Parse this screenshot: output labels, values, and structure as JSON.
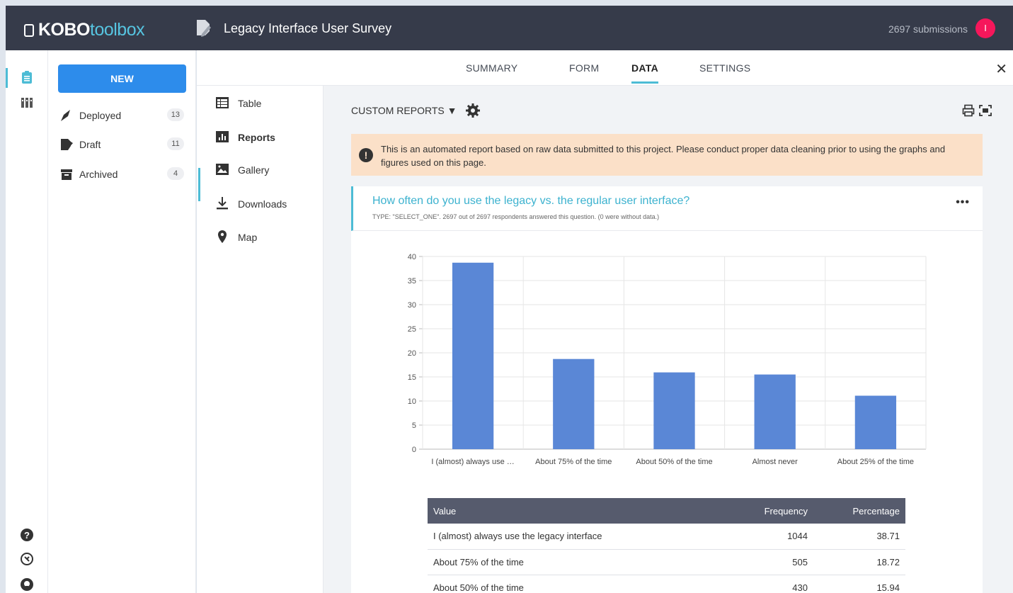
{
  "app": {
    "logo_bold": "KOBO",
    "logo_light": "toolbox",
    "project_title": "Legacy Interface User Survey",
    "submissions": "2697 submissions",
    "avatar_initial": "I",
    "accent_color": "#4dbcd5",
    "brand_blue": "#2d8ceb"
  },
  "rail": {
    "icons": [
      "clipboard-icon",
      "library-icon",
      "help-icon",
      "support-icon",
      "github-icon"
    ]
  },
  "sidebar": {
    "new_label": "NEW",
    "items": [
      {
        "label": "Deployed",
        "count": "13",
        "icon": "rocket-icon"
      },
      {
        "label": "Draft",
        "count": "11",
        "icon": "draft-icon"
      },
      {
        "label": "Archived",
        "count": "4",
        "icon": "archive-icon"
      }
    ]
  },
  "tabs": [
    {
      "label": "SUMMARY"
    },
    {
      "label": "FORM"
    },
    {
      "label": "DATA",
      "active": true
    },
    {
      "label": "SETTINGS"
    }
  ],
  "subnav": [
    {
      "label": "Table",
      "icon": "table-icon"
    },
    {
      "label": "Reports",
      "icon": "reports-icon",
      "active": true
    },
    {
      "label": "Gallery",
      "icon": "gallery-icon"
    },
    {
      "label": "Downloads",
      "icon": "download-icon"
    },
    {
      "label": "Map",
      "icon": "map-pin-icon"
    }
  ],
  "reports": {
    "custom_reports_label": "CUSTOM REPORTS ▼",
    "warning": "This is an automated report based on raw data submitted to this project. Please conduct proper data cleaning prior to using the graphs and figures used on this page.",
    "question": "How often do you use the legacy vs. the regular user interface?",
    "question_meta": "TYPE: \"SELECT_ONE\". 2697 out of 2697 respondents answered this question. (0 were without data.)",
    "more_label": "•••",
    "table": {
      "headers": [
        "Value",
        "Frequency",
        "Percentage"
      ],
      "rows": [
        [
          "I (almost) always use the legacy interface",
          "1044",
          "38.71"
        ],
        [
          "About 75% of the time",
          "505",
          "18.72"
        ],
        [
          "About 50% of the time",
          "430",
          "15.94"
        ]
      ]
    }
  },
  "chart_data": {
    "type": "bar",
    "categories": [
      "I (almost) always use …",
      "About 75% of the time",
      "About 50% of the time",
      "Almost never",
      "About 25% of the time"
    ],
    "values": [
      38.71,
      18.72,
      15.94,
      15.5,
      11.1
    ],
    "ylim": [
      0,
      40
    ],
    "yticks": [
      0,
      5,
      10,
      15,
      20,
      25,
      30,
      35,
      40
    ],
    "bar_color": "#5a87d6",
    "grid": true
  }
}
